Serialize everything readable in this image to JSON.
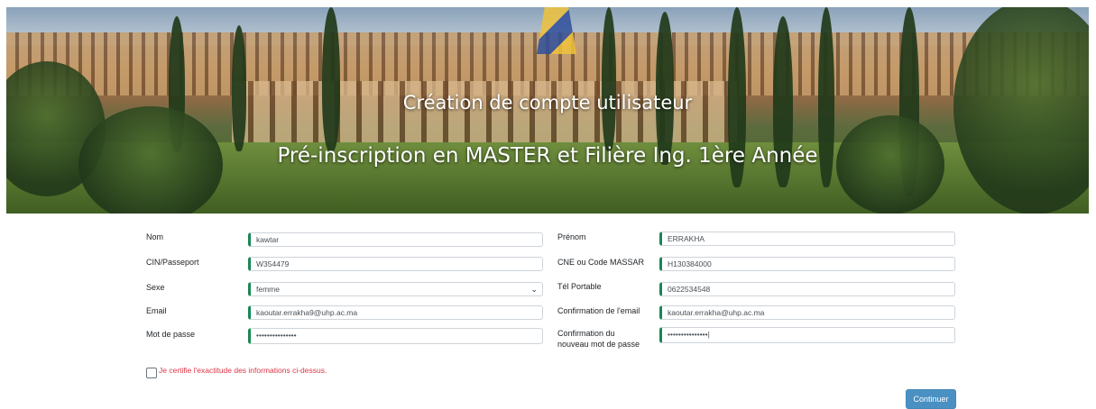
{
  "banner": {
    "title": "Création de compte utilisateur",
    "subtitle": "Pré-inscription en MASTER et Filière Ing. 1ère Année"
  },
  "form": {
    "nom": {
      "label": "Nom",
      "value": "kawtar"
    },
    "prenom": {
      "label": "Prénom",
      "value": "ERRAKHA"
    },
    "cin": {
      "label": "CIN/Passeport",
      "value": "W354479"
    },
    "cne": {
      "label": "CNE ou Code MASSAR",
      "value": "H130384000"
    },
    "sexe": {
      "label": "Sexe",
      "value": "femme"
    },
    "tel": {
      "label": "Tél Portable",
      "value": "0622534548"
    },
    "email": {
      "label": "Email",
      "value": "kaoutar.errakha9@uhp.ac.ma"
    },
    "email_confirm": {
      "label": "Confirmation de l'email",
      "value": "kaoutar.errakha@uhp.ac.ma"
    },
    "password": {
      "label": "Mot de passe",
      "value": "•••••••••••••••"
    },
    "password_confirm": {
      "label_line1": "Confirmation du",
      "label_line2": "nouveau mot de passe",
      "value": "•••••••••••••••|"
    },
    "certify_label": "Je certifie l'exactitude des informations ci-dessus.",
    "submit_label": "Continuer"
  },
  "colors": {
    "field_accent": "#198754",
    "button": "#4a90c2",
    "warning_text": "#dc3545"
  }
}
